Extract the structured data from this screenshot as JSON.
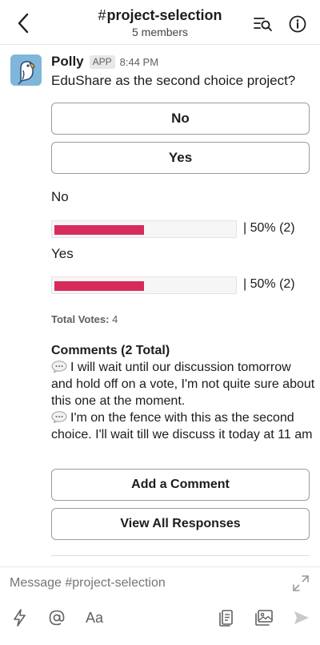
{
  "header": {
    "hash": "#",
    "channel_name": "project-selection",
    "member_count": "5 members"
  },
  "message": {
    "sender": "Polly",
    "badge": "APP",
    "time": "8:44 PM",
    "question": "EduShare as the second choice project?",
    "vote_buttons": [
      "No",
      "Yes"
    ],
    "results": [
      {
        "label": "No",
        "percent_value": 50,
        "display": "| 50% (2)"
      },
      {
        "label": "Yes",
        "percent_value": 50,
        "display": "| 50% (2)"
      }
    ],
    "total_votes_label": "Total Votes:",
    "total_votes_value": "4",
    "comments_title": "Comments (2 Total)",
    "comments": [
      "I will wait until our discussion tomorrow and hold off on a vote, I'm not quite sure about this one at the moment.",
      "I'm on the fence with this as the second choice. I'll wait till we discuss it today at 11 am"
    ],
    "add_comment_label": "Add a Comment",
    "view_responses_label": "View All Responses"
  },
  "composer": {
    "placeholder": "Message #project-selection",
    "format_label": "Aa"
  },
  "colors": {
    "bar_fill": "#d72b5c",
    "avatar_bg": "#7fb6da"
  },
  "icons": [
    "chevron-left-icon",
    "search-list-icon",
    "info-icon",
    "speech-bubble-icon",
    "expand-icon",
    "lightning-icon",
    "at-icon",
    "attachment-icon",
    "image-icon",
    "send-icon"
  ]
}
